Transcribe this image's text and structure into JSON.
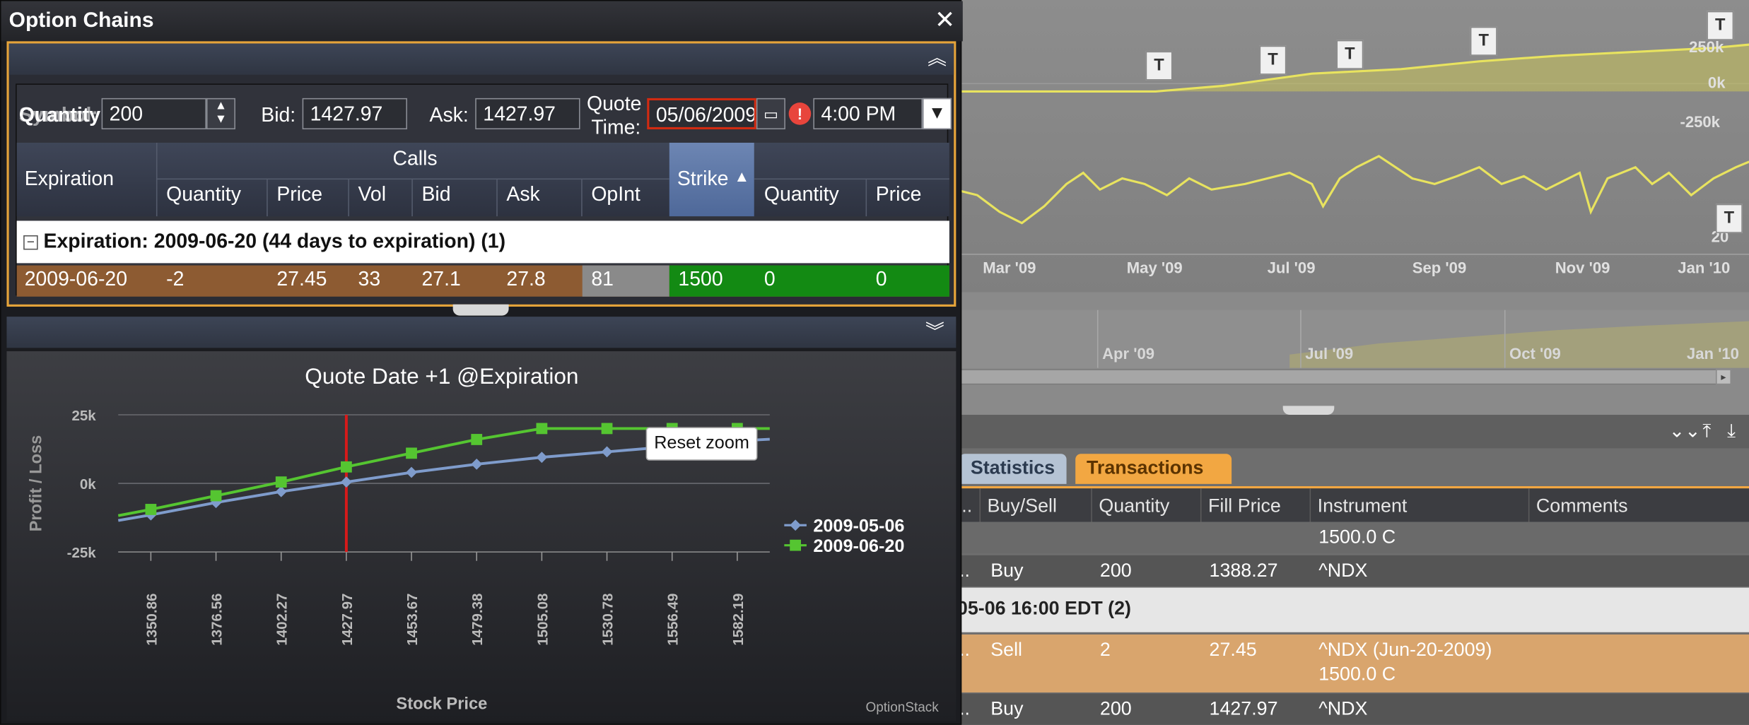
{
  "background": {
    "axis_months": [
      "Mar '09",
      "May '09",
      "Jul '09",
      "Sep '09",
      "Nov '09",
      "Jan '10"
    ],
    "y_labels": [
      "250k",
      "0k",
      "-250k",
      "20"
    ],
    "nav_months": [
      "Apr '09",
      "Jul '09",
      "Oct '09",
      "Jan '10"
    ],
    "marker_label": "T",
    "tabs": [
      "Statistics",
      "Transactions"
    ],
    "columns": [
      "..",
      "Buy/Sell",
      "Quantity",
      "Fill Price",
      "Instrument",
      "Comments"
    ],
    "rows": [
      {
        "buy_sell": "",
        "quantity": "",
        "fill_price": "",
        "instrument": "1500.0 C",
        "lead": ""
      },
      {
        "buy_sell": "Buy",
        "quantity": "200",
        "fill_price": "1388.27",
        "instrument": "^NDX",
        "lead": ".."
      },
      {
        "group": "05-06 16:00 EDT (2)"
      },
      {
        "buy_sell": "Sell",
        "quantity": "2",
        "fill_price": "27.45",
        "instrument": "^NDX (Jun-20-2009)",
        "instrument2": "1500.0 C",
        "lead": ".."
      },
      {
        "buy_sell": "Buy",
        "quantity": "200",
        "fill_price": "1427.97",
        "instrument": "^NDX",
        "lead": ".."
      }
    ]
  },
  "window": {
    "title": "Option Chains",
    "close_symbol": "✕"
  },
  "form": {
    "quantity_label": "Quantity:",
    "quantity_overlap": "Symbol:",
    "quantity": "200",
    "bid_label": "Bid:",
    "bid": "1427.97",
    "ask_label": "Ask:",
    "ask": "1427.97",
    "quote_label_1": "Quote",
    "quote_label_2": "Time:",
    "quote_date": "05/06/2009",
    "time": "4:00 PM"
  },
  "grid": {
    "expiration_header": "Expiration",
    "calls_header": "Calls",
    "strike_header": "Strike",
    "call_columns": [
      "Quantity",
      "Price",
      "Vol",
      "Bid",
      "Ask",
      "OpInt"
    ],
    "put_columns": [
      "Quantity",
      "Price"
    ],
    "group_label": "Expiration: 2009-06-20 (44 days to expiration) (1)",
    "row": {
      "expiration": "2009-06-20",
      "quantity": "-2",
      "price": "27.45",
      "vol": "33",
      "bid": "27.1",
      "ask": "27.8",
      "opint": "81",
      "strike": "1500",
      "put_quantity": "0",
      "put_price": "0"
    }
  },
  "chart_data": {
    "type": "line",
    "title": "Quote Date +1 @Expiration",
    "xlabel": "Stock Price",
    "ylabel": "Profit / Loss",
    "x": [
      1350.86,
      1376.56,
      1402.27,
      1427.97,
      1453.67,
      1479.38,
      1505.08,
      1530.78,
      1556.49,
      1582.19
    ],
    "x_tick_labels": [
      "1350.86",
      "1376.56",
      "1402.27",
      "1427.97",
      "1453.67",
      "1479.38",
      "1505.08",
      "1530.78",
      "1556.49",
      "1582.19"
    ],
    "y_tick_labels": [
      "25k",
      "0k",
      "-25k"
    ],
    "ylim": [
      -25000,
      25000
    ],
    "xlim": [
      1338,
      1595
    ],
    "current_price": 1427.97,
    "series": [
      {
        "name": "2009-05-06",
        "color": "#7f9ccc",
        "marker": "diamond",
        "values": [
          -11500,
          -7000,
          -3000,
          500,
          4000,
          7000,
          9500,
          11500,
          13500,
          15500
        ]
      },
      {
        "name": "2009-06-20",
        "color": "#55c531",
        "marker": "square",
        "values": [
          -9500,
          -4500,
          500,
          6000,
          11000,
          16000,
          20000,
          20000,
          20000,
          20000
        ]
      }
    ],
    "legend_position": "right",
    "reset_label": "Reset zoom",
    "brand": "OptionStack"
  }
}
